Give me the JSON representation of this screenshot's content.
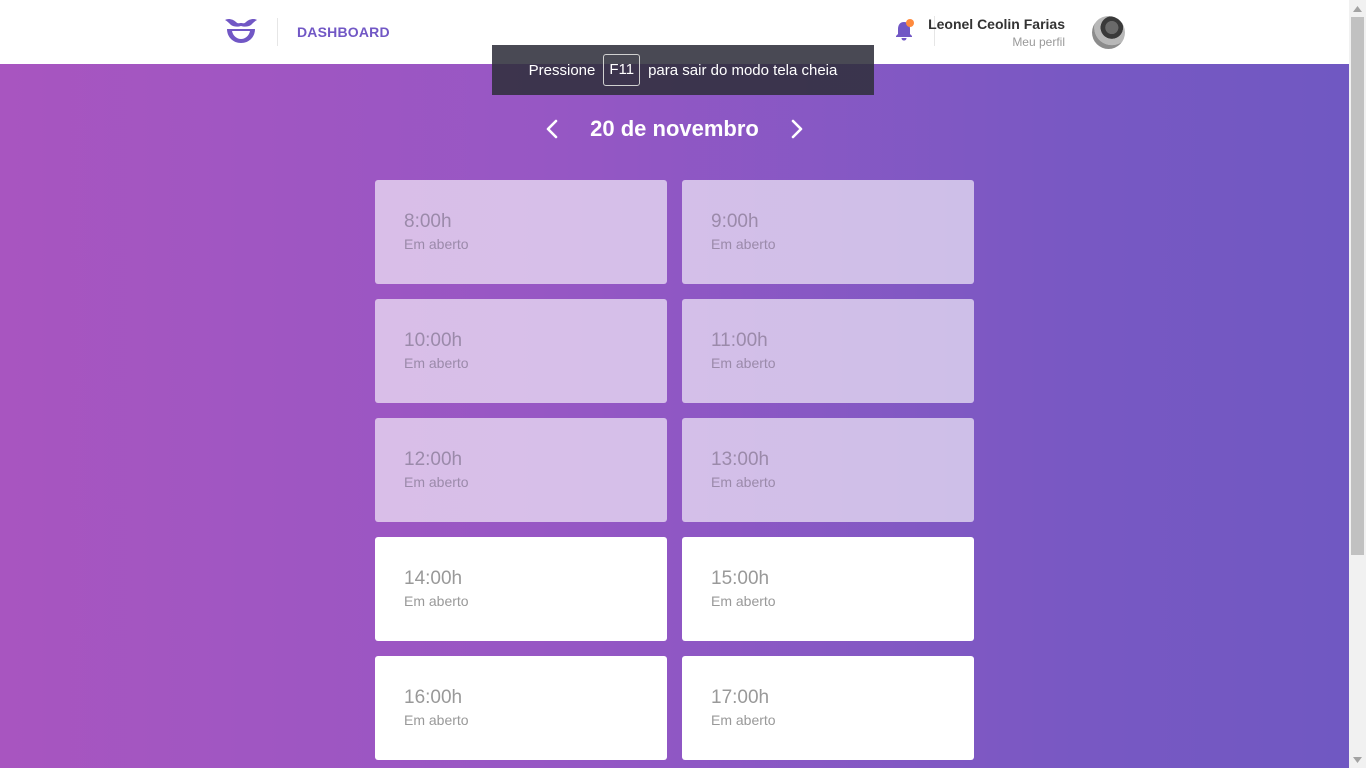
{
  "header": {
    "dashboard_label": "DASHBOARD",
    "user_name": "Leonel Ceolin Farias",
    "profile_link": "Meu perfil"
  },
  "toast": {
    "before": "Pressione",
    "key": "F11",
    "after": "para sair do modo tela cheia"
  },
  "date_nav": {
    "title": "20 de novembro"
  },
  "slots": [
    {
      "time": "8:00h",
      "status": "Em aberto",
      "state": "past"
    },
    {
      "time": "9:00h",
      "status": "Em aberto",
      "state": "past"
    },
    {
      "time": "10:00h",
      "status": "Em aberto",
      "state": "past"
    },
    {
      "time": "11:00h",
      "status": "Em aberto",
      "state": "past"
    },
    {
      "time": "12:00h",
      "status": "Em aberto",
      "state": "past"
    },
    {
      "time": "13:00h",
      "status": "Em aberto",
      "state": "past"
    },
    {
      "time": "14:00h",
      "status": "Em aberto",
      "state": "open"
    },
    {
      "time": "15:00h",
      "status": "Em aberto",
      "state": "open"
    },
    {
      "time": "16:00h",
      "status": "Em aberto",
      "state": "open"
    },
    {
      "time": "17:00h",
      "status": "Em aberto",
      "state": "open"
    }
  ],
  "colors": {
    "accent": "#7157c5",
    "notification_dot": "#ff8a3d",
    "gradient_start": "#a855c0",
    "gradient_end": "#7058c2"
  },
  "icons": {
    "logo": "mustache-smile-icon",
    "notifications": "bell-icon",
    "prev": "chevron-left-icon",
    "next": "chevron-right-icon"
  }
}
